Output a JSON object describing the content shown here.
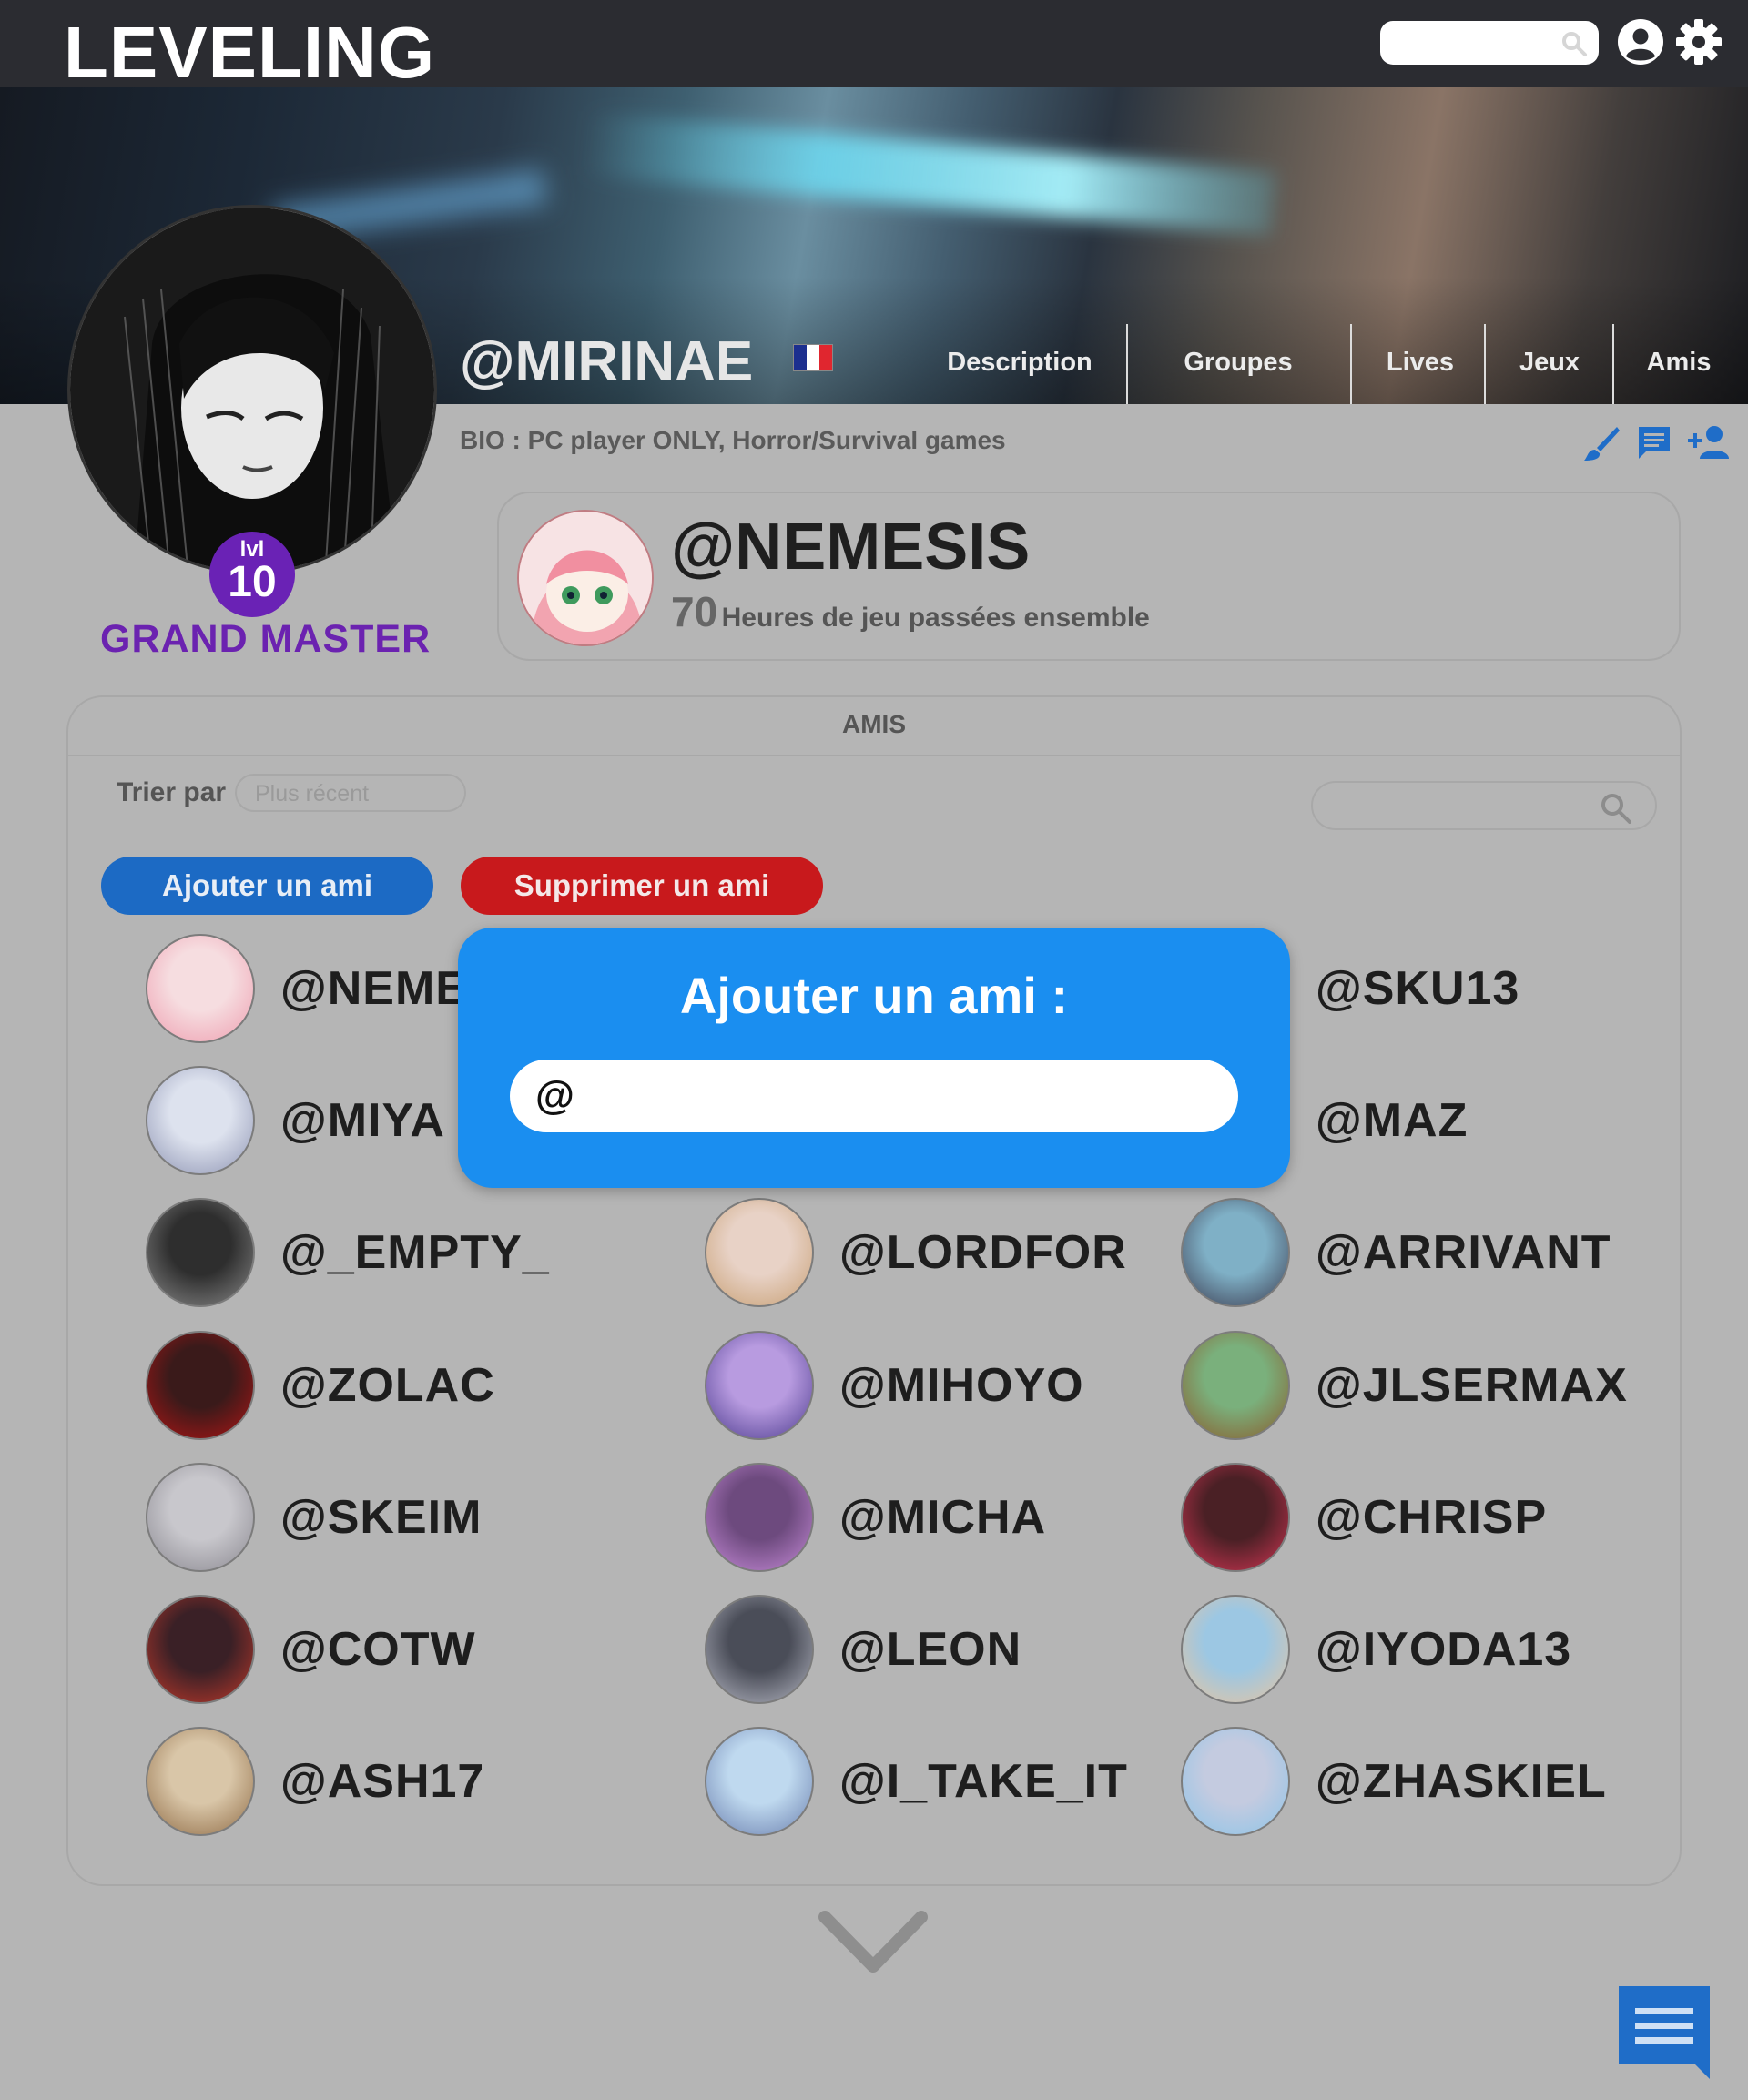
{
  "header": {
    "logo": "LEVELING",
    "search_placeholder": ""
  },
  "profile": {
    "username": "@MIRINAE",
    "flag_colors": [
      "#1c2f8f",
      "#ffffff",
      "#e0262f"
    ],
    "bio": "BIO : PC player ONLY, Horror/Survival games",
    "level_prefix": "lvl",
    "level": "10",
    "rank": "GRAND MASTER"
  },
  "nav": {
    "tabs": [
      {
        "label": "Description"
      },
      {
        "label": "Groupes"
      },
      {
        "label": "Lives"
      },
      {
        "label": "Jeux"
      },
      {
        "label": "Amis"
      }
    ]
  },
  "best_friend": {
    "name": "@NEMESIS",
    "hours": "70",
    "hours_label": "Heures de jeu passées ensemble"
  },
  "friends_panel": {
    "title": "AMIS",
    "sort_label": "Trier par",
    "sort_value": "Plus récent",
    "search_placeholder": "",
    "add_button": "Ajouter un ami",
    "remove_button": "Supprimer un ami",
    "friends": [
      {
        "name": "@NEME",
        "col": 0
      },
      {
        "name": "@SKU13",
        "col": 2
      },
      {
        "name": "@MIYA",
        "col": 0
      },
      {
        "name": "@MAZ",
        "col": 2
      },
      {
        "name": "@_EMPTY_",
        "col": 0
      },
      {
        "name": "@LORDFOR",
        "col": 1
      },
      {
        "name": "@ARRIVANT",
        "col": 2
      },
      {
        "name": "@ZOLAC",
        "col": 0
      },
      {
        "name": "@MIHOYO",
        "col": 1
      },
      {
        "name": "@JLSERMAX",
        "col": 2
      },
      {
        "name": "@SKEIM",
        "col": 0
      },
      {
        "name": "@MICHA",
        "col": 1
      },
      {
        "name": "@CHRISP",
        "col": 2
      },
      {
        "name": "@COTW",
        "col": 0
      },
      {
        "name": "@LEON",
        "col": 1
      },
      {
        "name": "@IYODA13",
        "col": 2
      },
      {
        "name": "@ASH17",
        "col": 0
      },
      {
        "name": "@I_TAKE_IT",
        "col": 1
      },
      {
        "name": "@ZHASKIEL",
        "col": 2
      }
    ]
  },
  "modal": {
    "title": "Ajouter un ami :",
    "input_value": "@"
  },
  "colors": {
    "topbar": "#2b2c31",
    "modal_bg": "#1a8ef0",
    "add_button": "#1c6ac4",
    "remove_button": "#c8191c",
    "rank_purple": "#6b22b0",
    "page_bg": "#b5b5b5"
  },
  "icons": [
    "search-icon",
    "account-icon",
    "settings-icon",
    "brush-icon",
    "message-icon",
    "add-friend-icon",
    "chevron-down-icon",
    "chat-icon"
  ]
}
